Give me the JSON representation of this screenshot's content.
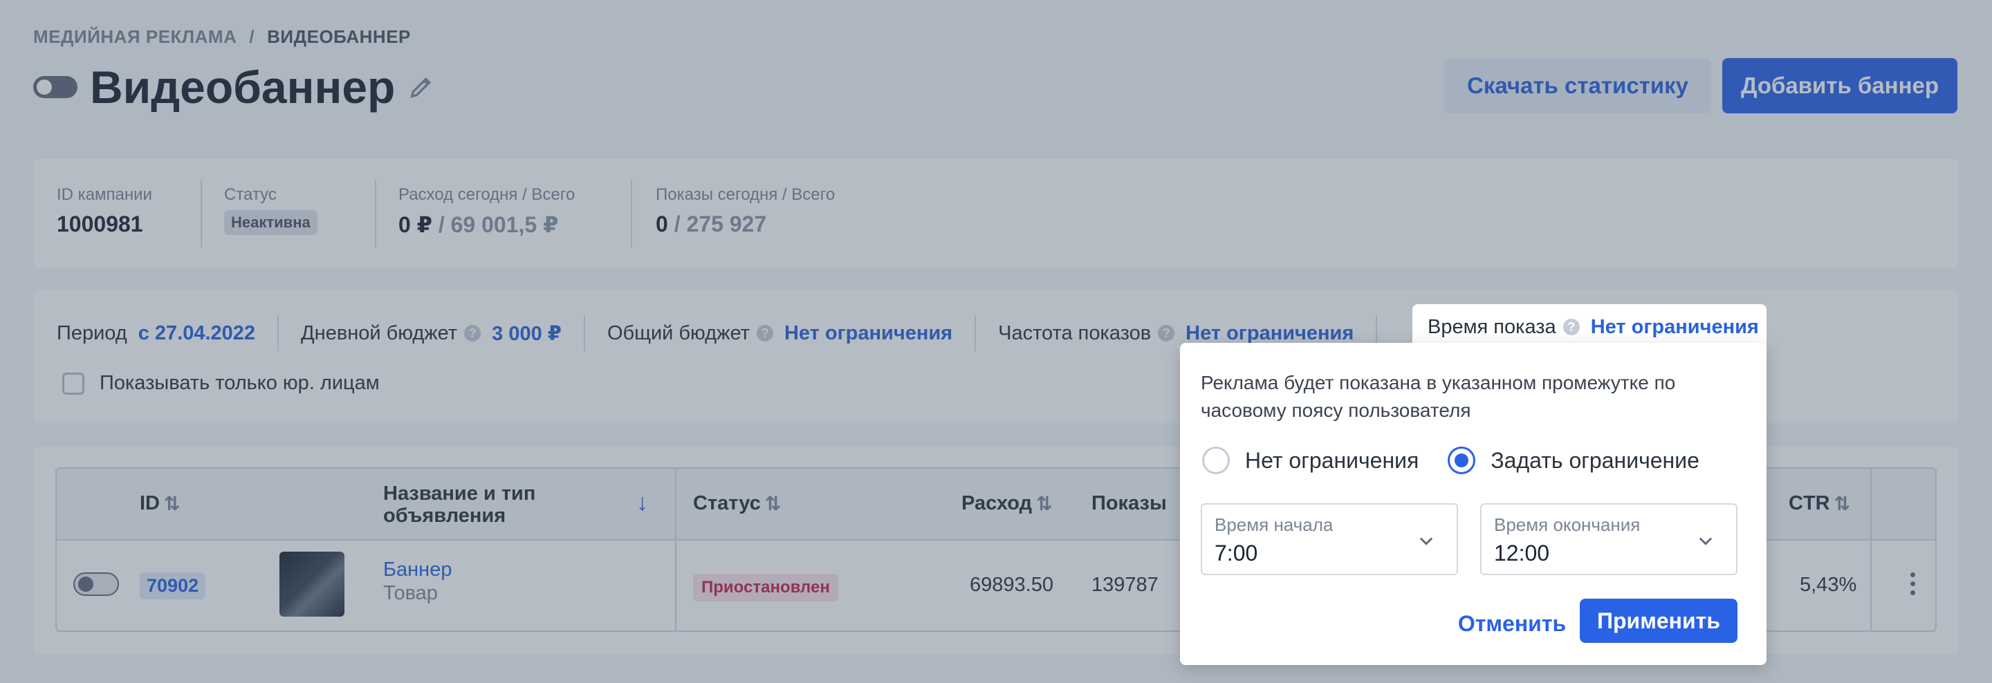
{
  "breadcrumb": {
    "parent": "МЕДИЙНАЯ РЕКЛАМА",
    "separator": "/",
    "current": "ВИДЕОБАННЕР"
  },
  "page": {
    "title": "Видеобаннер"
  },
  "actions": {
    "download_stats": "Скачать статистику",
    "add_banner": "Добавить баннер"
  },
  "info": {
    "campaign_id_label": "ID кампании",
    "campaign_id": "1000981",
    "status_label": "Статус",
    "status": "Неактивна",
    "spend_label": "Расход сегодня / Всего",
    "spend_today": "0 ₽",
    "spend_total": "/ 69 001,5 ₽",
    "impressions_label": "Показы сегодня / Всего",
    "impressions_today": "0",
    "impressions_total": "/ 275 927"
  },
  "settings": {
    "period_label": "Период",
    "period_value": "с 27.04.2022",
    "daily_budget_label": "Дневной бюджет",
    "daily_budget_value": "3 000 ₽",
    "total_budget_label": "Общий бюджет",
    "total_budget_value": "Нет ограничения",
    "frequency_label": "Частота показов",
    "frequency_value": "Нет ограничения",
    "show_time_label": "Время показа",
    "show_time_value": "Нет ограничения",
    "legal_only_label": "Показывать только юр. лицам",
    "help_glyph": "?"
  },
  "table": {
    "headers": {
      "id": "ID",
      "name": "Название и тип объявления",
      "status": "Статус",
      "spend": "Расход",
      "impressions": "Показы",
      "ctr": "CTR"
    },
    "rows": [
      {
        "id": "70902",
        "name": "Баннер",
        "type": "Товар",
        "status": "Приостановлен",
        "spend": "69893.50",
        "impressions": "139787",
        "ctr": "5,43%"
      }
    ]
  },
  "popover": {
    "description": "Реклама будет показана в указанном промежутке по часовому поясу пользователя",
    "option_none": "Нет ограничения",
    "option_set": "Задать ограничение",
    "selected_option": "Задать ограничение",
    "start_label": "Время начала",
    "start_value": "7:00",
    "end_label": "Время окончания",
    "end_value": "12:00",
    "cancel": "Отменить",
    "apply": "Применить"
  },
  "colors": {
    "accent": "#2a62e6",
    "danger": "#c2244b"
  }
}
